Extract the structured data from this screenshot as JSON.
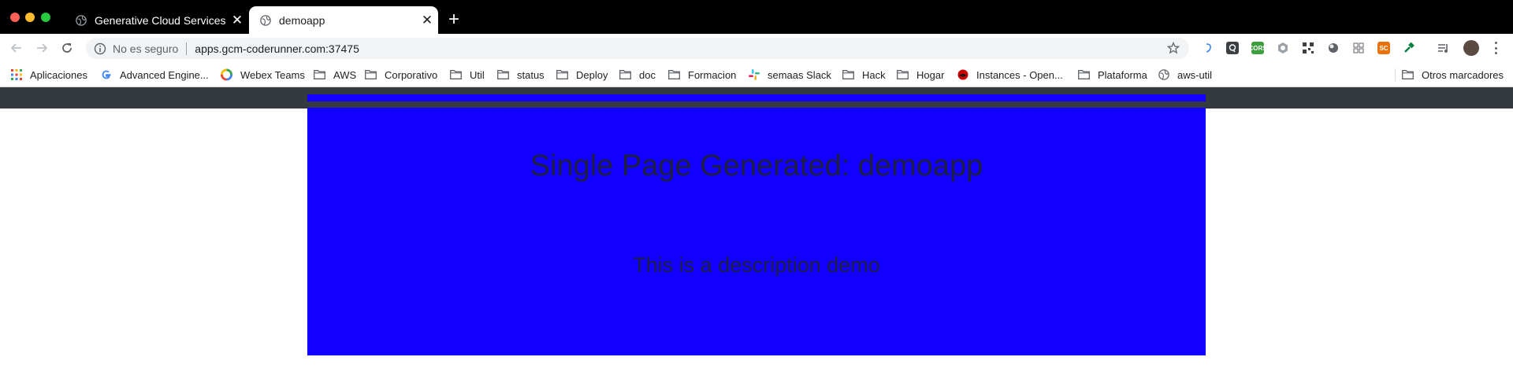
{
  "browser": {
    "tabs": [
      {
        "title": "Generative Cloud Services",
        "active": false
      },
      {
        "title": "demoapp",
        "active": true
      }
    ],
    "new_tab_label": "+",
    "close_glyph": "✕",
    "address_bar": {
      "security_label": "No es seguro",
      "url": "apps.gcm-coderunner.com:37475"
    },
    "extension_icons": [
      "refresh-extension-icon",
      "q-extension-icon",
      "cors-extension-icon",
      "hexagon-extension-icon",
      "qr-extension-icon",
      "circle-extension-icon",
      "grid-extension-icon",
      "sc-extension-icon",
      "hammer-extension-icon"
    ],
    "extension_labels": {
      "cors": "CORS",
      "sc": "SC"
    }
  },
  "bookmarks": [
    {
      "label": "Aplicaciones",
      "icon": "apps-grid-icon"
    },
    {
      "label": "Advanced Engine...",
      "icon": "google-icon"
    },
    {
      "label": "Webex Teams",
      "icon": "webex-icon"
    },
    {
      "label": "AWS",
      "icon": "folder-icon"
    },
    {
      "label": "Corporativo",
      "icon": "folder-icon"
    },
    {
      "label": "Util",
      "icon": "folder-icon"
    },
    {
      "label": "status",
      "icon": "folder-icon"
    },
    {
      "label": "Deploy",
      "icon": "folder-icon"
    },
    {
      "label": "doc",
      "icon": "folder-icon"
    },
    {
      "label": "Formacion",
      "icon": "folder-icon"
    },
    {
      "label": "semaas Slack",
      "icon": "slack-icon"
    },
    {
      "label": "Hack",
      "icon": "folder-icon"
    },
    {
      "label": "Hogar",
      "icon": "folder-icon"
    },
    {
      "label": "Instances - Open...",
      "icon": "openshift-icon"
    },
    {
      "label": "Plataforma",
      "icon": "folder-icon"
    },
    {
      "label": "aws-util",
      "icon": "globe-icon"
    }
  ],
  "other_bookmarks": {
    "label": "Otros marcadores",
    "icon": "folder-icon"
  },
  "page": {
    "title": "Single Page Generated: demoapp",
    "description": "This is a description demo"
  },
  "colors": {
    "hero_background": "#1100ff",
    "header_bar": "#343a40",
    "heading_text": "#1e1e40"
  }
}
